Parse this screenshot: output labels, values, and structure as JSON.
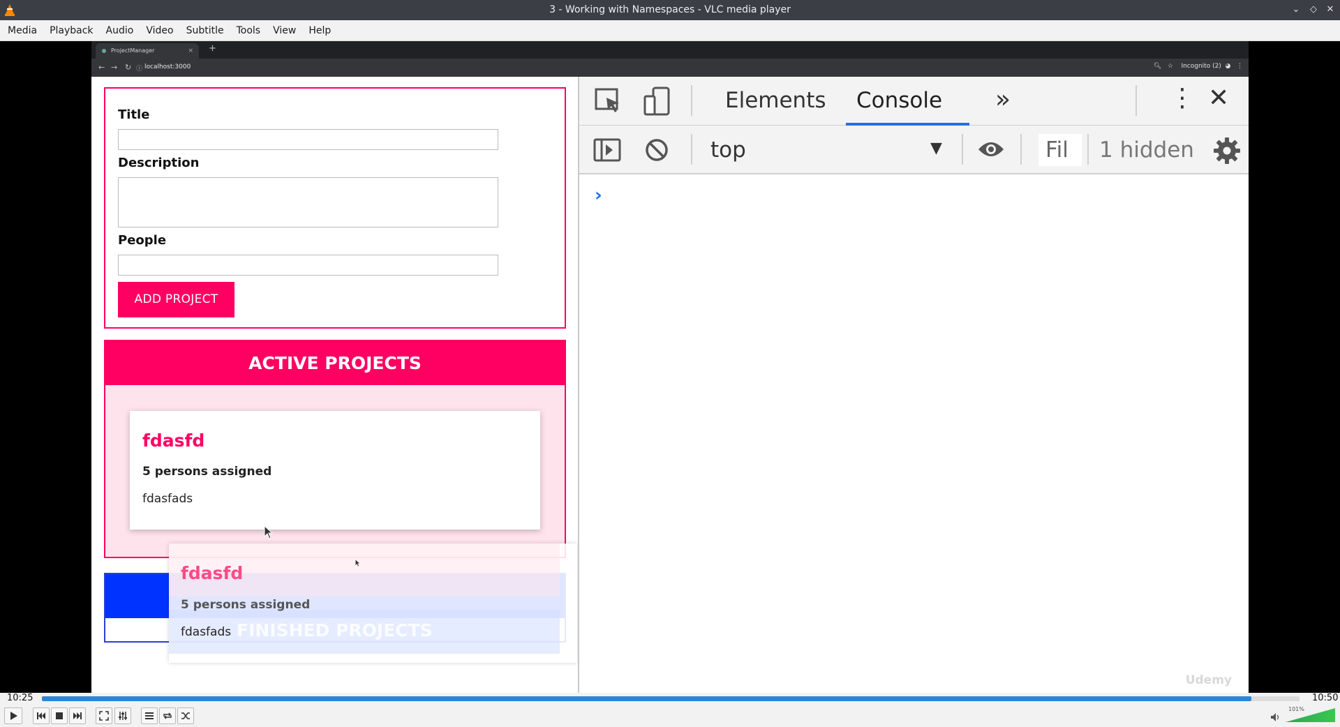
{
  "window": {
    "title": "3 - Working with Namespaces - VLC media player"
  },
  "menu": [
    "Media",
    "Playback",
    "Audio",
    "Video",
    "Subtitle",
    "Tools",
    "View",
    "Help"
  ],
  "browser": {
    "tab_title": "ProjectManager",
    "tab_close": "×",
    "new_tab": "+",
    "url": "localhost:3000",
    "profile": "Incognito (2)"
  },
  "form": {
    "title_label": "Title",
    "description_label": "Description",
    "people_label": "People",
    "submit_label": "ADD PROJECT"
  },
  "active_projects": {
    "heading": "ACTIVE PROJECTS",
    "card": {
      "title": "fdasfd",
      "persons": "5 persons assigned",
      "description": "fdasfads"
    }
  },
  "finished_projects": {
    "heading": "FINISHED PROJECTS"
  },
  "drag_ghost": {
    "title": "fdasfd",
    "persons": "5 persons assigned",
    "description": "fdasfads"
  },
  "devtools": {
    "tabs": [
      "Elements",
      "Console"
    ],
    "active_tab": "Console",
    "context": "top",
    "filter_placeholder": "Fil",
    "hidden_count": "1 hidden",
    "prompt": "›"
  },
  "watermark": "Udemy",
  "player": {
    "elapsed": "10:25",
    "total": "10:50",
    "progress": 0.9615,
    "volume_label": "101%",
    "volume": 1.01,
    "accent": "#2b87d6"
  }
}
